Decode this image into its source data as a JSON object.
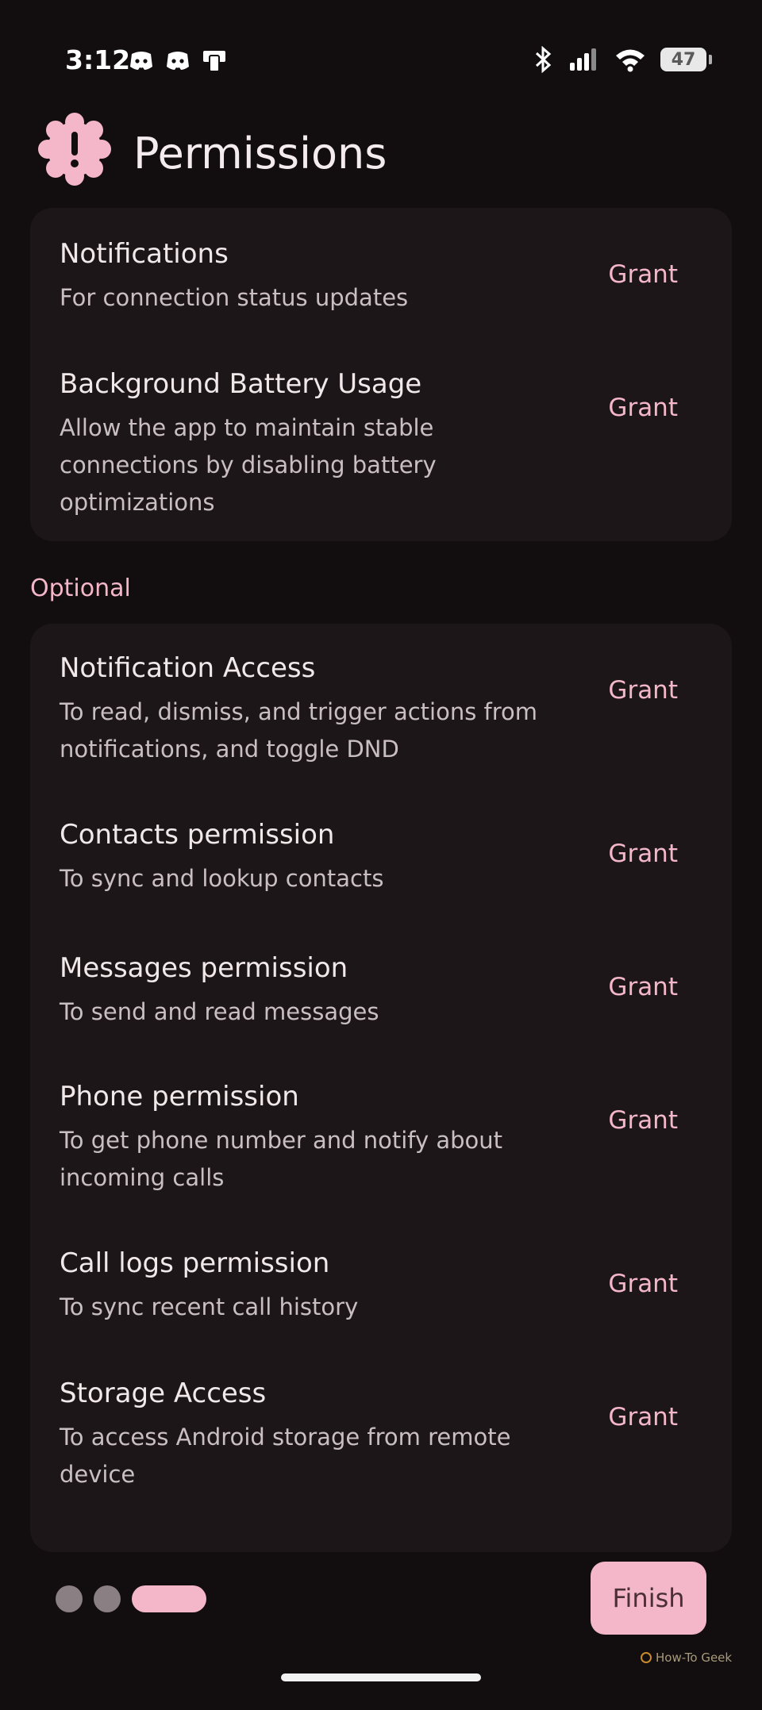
{
  "status_bar": {
    "time": "3:12",
    "battery_level": "47",
    "left_icons": [
      "discord-icon",
      "discord-icon",
      "device-icon"
    ],
    "right_icons": [
      "bluetooth-icon",
      "signal-icon",
      "wifi-icon",
      "battery-icon"
    ]
  },
  "header": {
    "title": "Permissions",
    "icon": "alert-gear-icon"
  },
  "required": {
    "items": [
      {
        "title": "Notifications",
        "description": "For connection status updates",
        "action": "Grant"
      },
      {
        "title": "Background Battery Usage",
        "description": "Allow the app to maintain stable connections by disabling battery optimizations",
        "action": "Grant"
      }
    ]
  },
  "optional": {
    "label": "Optional",
    "items": [
      {
        "title": "Notification Access",
        "description": "To read, dismiss, and trigger actions from notifications, and toggle DND",
        "action": "Grant"
      },
      {
        "title": "Contacts permission",
        "description": "To sync and lookup contacts",
        "action": "Grant"
      },
      {
        "title": "Messages permission",
        "description": "To send and read messages",
        "action": "Grant"
      },
      {
        "title": "Phone permission",
        "description": "To get phone number and notify about incoming calls",
        "action": "Grant"
      },
      {
        "title": "Call logs permission",
        "description": "To sync recent call history",
        "action": "Grant"
      },
      {
        "title": "Storage Access",
        "description": "To access Android storage from remote device",
        "action": "Grant"
      }
    ]
  },
  "footer": {
    "finish_label": "Finish",
    "pages_total": 3,
    "current_page": 3,
    "watermark": "How-To Geek"
  },
  "colors": {
    "accent": "#f4b7ca",
    "background": "#120d0e",
    "card": "#1c1618"
  }
}
